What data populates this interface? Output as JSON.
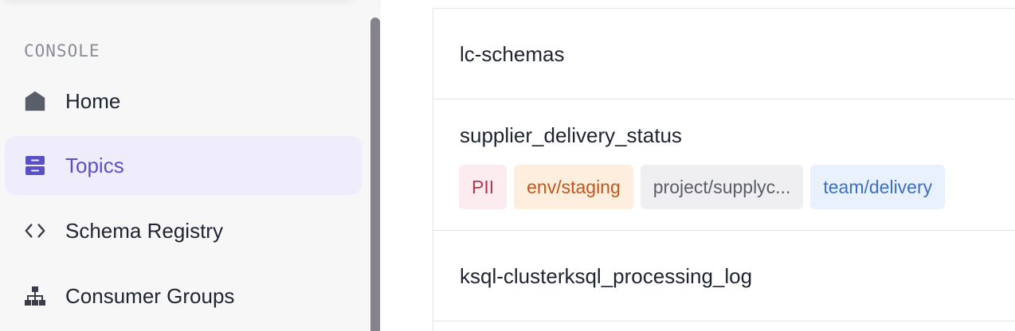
{
  "sidebar": {
    "section_label": "CONSOLE",
    "items": [
      {
        "label": "Home",
        "icon": "home-icon"
      },
      {
        "label": "Topics",
        "icon": "topics-icon",
        "active": true
      },
      {
        "label": "Schema Registry",
        "icon": "code-icon"
      },
      {
        "label": "Consumer Groups",
        "icon": "hierarchy-icon"
      }
    ]
  },
  "topics": [
    {
      "name": "lc-schemas",
      "tags": []
    },
    {
      "name": "supplier_delivery_status",
      "tags": [
        "PII",
        "env/staging",
        "project/supplyc...",
        "team/delivery"
      ]
    },
    {
      "name": "ksql-clusterksql_processing_log",
      "tags": []
    }
  ],
  "colors": {
    "accent": "#5b4fc6",
    "active_bg": "#efedfb",
    "tag_pii": "#b33a4c",
    "tag_env": "#c0561e",
    "tag_project": "#5a5d66",
    "tag_team": "#3a6fc4"
  }
}
